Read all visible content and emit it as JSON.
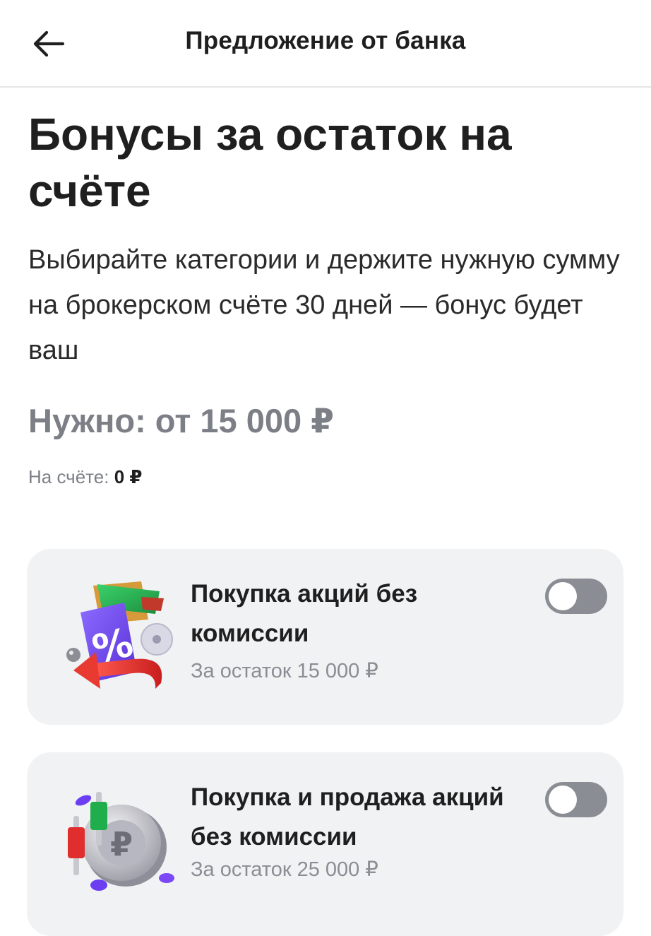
{
  "header": {
    "title": "Предложение от банка",
    "back_icon": "arrow-left-icon"
  },
  "main": {
    "title": "Бонусы за остаток на счёте",
    "description": "Выбирайте категории и держите нужную сумму на брокерском счёте 30 дней — бонус будет ваш",
    "required": "Нужно: от 15 000 ₽",
    "balance_label": "На счёте:",
    "balance_value": "0 ₽"
  },
  "categories": [
    {
      "title": "Покупка акций без комиссии",
      "subtitle": "За остаток 15 000 ₽",
      "enabled": false,
      "icon": "percent-folder-icon"
    },
    {
      "title": "Покупка и продажа акций без комиссии",
      "subtitle": "За остаток 25 000 ₽",
      "enabled": false,
      "icon": "ruble-coin-candles-icon"
    }
  ],
  "colors": {
    "text": "#1f1f1f",
    "muted": "#7c7f86",
    "card_bg": "#f1f2f4",
    "toggle_off": "#8a8d93"
  }
}
